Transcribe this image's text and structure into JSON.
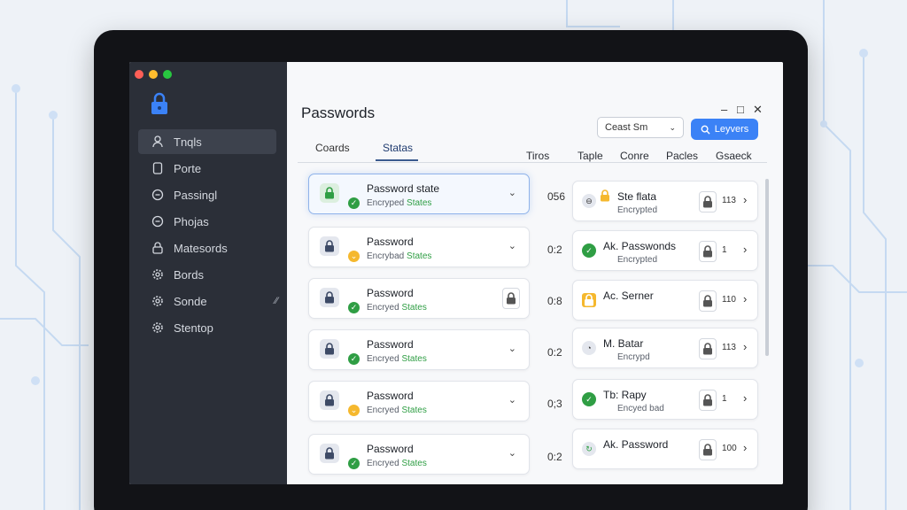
{
  "colors": {
    "sidebar_bg": "#2b2f38",
    "accent": "#3b82f6",
    "success": "#2f9e44",
    "warning": "#f5b82e"
  },
  "window": {
    "controls": [
      "–",
      "□",
      "✕"
    ]
  },
  "sidebar": {
    "items": [
      {
        "label": "Tnqls",
        "icon": "person-icon",
        "active": true
      },
      {
        "label": "Porte",
        "icon": "phone-icon"
      },
      {
        "label": "Passingl",
        "icon": "circle-minus-icon"
      },
      {
        "label": "Phojas",
        "icon": "circle-minus-icon"
      },
      {
        "label": "Matesords",
        "icon": "lock-icon"
      },
      {
        "label": "Bords",
        "icon": "gear-icon"
      },
      {
        "label": "Sonde",
        "icon": "gear-icon",
        "extra": "⁄⁄"
      },
      {
        "label": "Stentop",
        "icon": "gear-icon"
      }
    ]
  },
  "main": {
    "title": "Passwords",
    "search_select": "Ceast Sm",
    "primary_button": "Leyvers",
    "tabs": [
      "Coards",
      "Statas"
    ],
    "columns": [
      "Tiros",
      "Taple",
      "Conre",
      "Pacles",
      "Gsaeck"
    ]
  },
  "cards": [
    {
      "title": "Password state",
      "sub": "Encryped",
      "status": "States",
      "badge": "green",
      "num": "056"
    },
    {
      "title": "Password",
      "sub": "Encrybad",
      "status": "States",
      "badge": "yellow",
      "num": "0:2"
    },
    {
      "title": "Password",
      "sub": "Encryed",
      "status": "States",
      "badge": "green",
      "num": "0:8"
    },
    {
      "title": "Password",
      "sub": "Encryed",
      "status": "States",
      "badge": "green",
      "num": "0:2"
    },
    {
      "title": "Password",
      "sub": "Encryed",
      "status": "States",
      "badge": "yellow",
      "num": "0;3"
    },
    {
      "title": "Password",
      "sub": "Encryed",
      "status": "States",
      "badge": "green",
      "num": "0:2"
    }
  ],
  "right_cards": [
    {
      "title": "Ste flata",
      "sub": "Encrypted",
      "count": "113"
    },
    {
      "title": "Ak. Passwonds",
      "sub": "Encrypted",
      "count": "1"
    },
    {
      "title": "Ac. Serner",
      "sub": "",
      "count": "110"
    },
    {
      "title": "M. Batar",
      "sub": "Encrypd",
      "count": "113"
    },
    {
      "title": "Tb: Rapy",
      "sub": "Encyed bad",
      "count": "1"
    },
    {
      "title": "Ak. Password",
      "sub": "",
      "count": "100"
    }
  ]
}
